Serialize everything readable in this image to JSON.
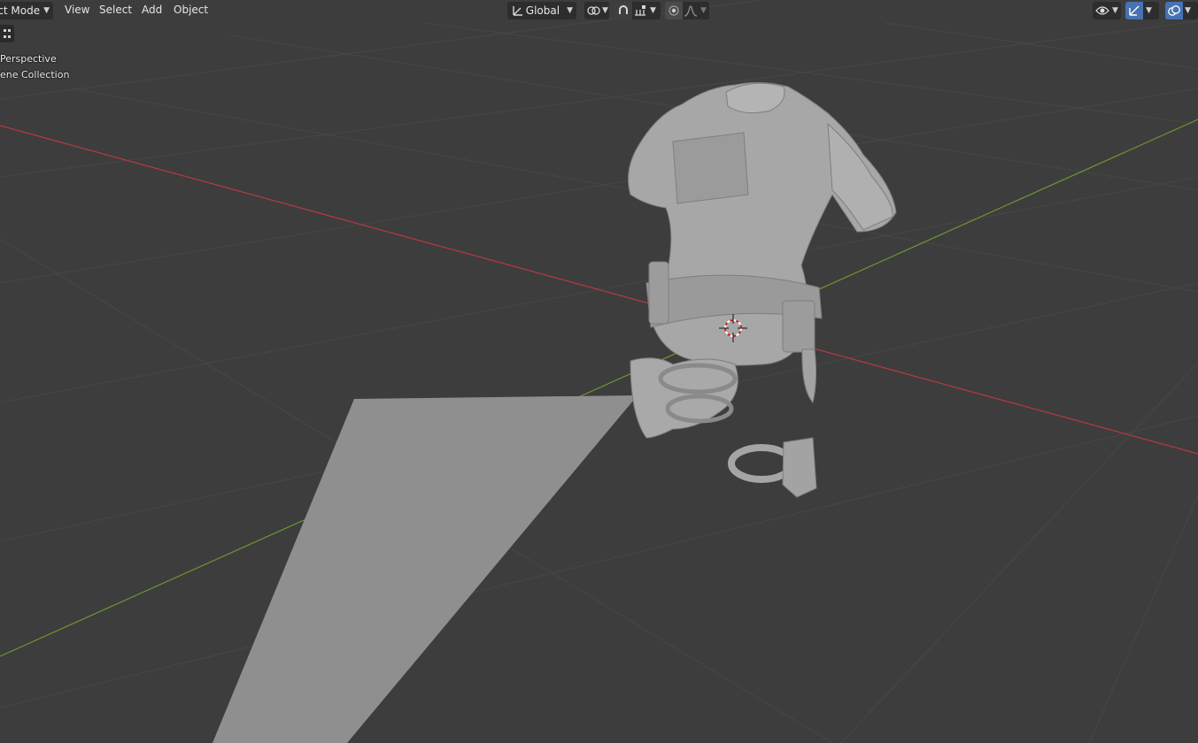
{
  "header": {
    "mode": "ct Mode",
    "menus": [
      "View",
      "Select",
      "Add",
      "Object"
    ],
    "transform_orientation": "Global"
  },
  "viewport": {
    "view_label": "Perspective",
    "collection_label": "ene Collection"
  },
  "colors": {
    "background": "#3d3d3d",
    "grid": "#484848",
    "x_axis": "#b8393f",
    "y_axis": "#6e9631",
    "model": "#a9a9a9",
    "plane": "#8f8f8f",
    "active_toggle": "#4772b3"
  },
  "icons": [
    "transform-orientation-icon",
    "pivot-icon",
    "snap-icon",
    "snap-increment-icon",
    "proportional-edit-icon",
    "falloff-icon",
    "visibility-icon",
    "gizmo-icon",
    "overlay-icon",
    "toolbar-toggle-icon",
    "3d-cursor-icon"
  ]
}
